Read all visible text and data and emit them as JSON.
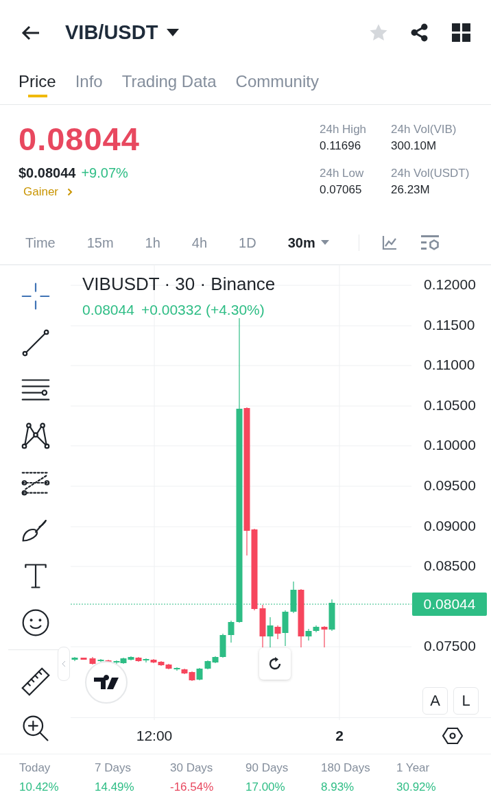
{
  "header": {
    "title": "VIB/USDT",
    "favorite": false
  },
  "tabs": [
    {
      "label": "Price",
      "selected": true
    },
    {
      "label": "Info",
      "selected": false
    },
    {
      "label": "Trading Data",
      "selected": false
    },
    {
      "label": "Community",
      "selected": false
    }
  ],
  "price": {
    "last": "0.08044",
    "usd": "$0.08044",
    "change": "+9.07%",
    "tag": "Gainer"
  },
  "stats": [
    {
      "label": "24h High",
      "value": "0.11696"
    },
    {
      "label": "24h Vol(VIB)",
      "value": "300.10M"
    },
    {
      "label": "24h Low",
      "value": "0.07065"
    },
    {
      "label": "24h Vol(USDT)",
      "value": "26.23M"
    }
  ],
  "intervals": [
    {
      "label": "Time",
      "selected": false
    },
    {
      "label": "15m",
      "selected": false
    },
    {
      "label": "1h",
      "selected": false
    },
    {
      "label": "4h",
      "selected": false
    },
    {
      "label": "1D",
      "selected": false
    },
    {
      "label": "30m",
      "selected": true
    }
  ],
  "tools": [
    {
      "kind": "crosshair",
      "selected": true
    },
    {
      "kind": "trendline",
      "selected": false
    },
    {
      "kind": "hlines",
      "selected": false
    },
    {
      "kind": "pattern",
      "selected": false
    },
    {
      "kind": "fib",
      "selected": false
    },
    {
      "kind": "brush",
      "selected": false
    },
    {
      "kind": "text",
      "selected": false
    },
    {
      "kind": "emoji",
      "selected": false
    },
    {
      "kind": "ruler",
      "selected": false
    },
    {
      "kind": "zoom",
      "selected": false
    }
  ],
  "chart": {
    "legend": "VIBUSDT · 30 · Binance",
    "quote": "0.08044",
    "quote_change": "+0.00332 (+4.30%)",
    "price_axis": [
      "0.12000",
      "0.11500",
      "0.11000",
      "0.10500",
      "0.10000",
      "0.09500",
      "0.09000",
      "0.08500",
      "0.07500"
    ],
    "price_tag": "0.08044",
    "time_axis": [
      {
        "label": "12:00",
        "bold": false
      },
      {
        "label": "2",
        "bold": true
      }
    ],
    "scale_buttons": [
      "A",
      "L"
    ]
  },
  "performance": [
    {
      "period": "Today",
      "value": "10.42%",
      "negative": false
    },
    {
      "period": "7 Days",
      "value": "14.49%",
      "negative": false
    },
    {
      "period": "30 Days",
      "value": "-16.54%",
      "negative": true
    },
    {
      "period": "90 Days",
      "value": "17.00%",
      "negative": false
    },
    {
      "period": "180 Days",
      "value": "8.93%",
      "negative": false
    },
    {
      "period": "1 Year",
      "value": "30.92%",
      "negative": false
    }
  ]
}
